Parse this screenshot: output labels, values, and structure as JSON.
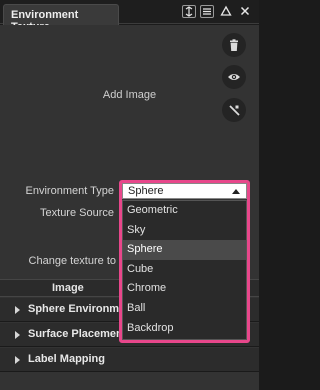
{
  "window": {
    "tab_title": "Environment Texture",
    "controls": [
      "pin-icon",
      "menu-icon",
      "triangle-icon",
      "close-icon"
    ]
  },
  "side_buttons": [
    "trash-icon",
    "eye-icon",
    "no-texture-icon"
  ],
  "add_image_label": "Add Image",
  "fields": {
    "environment_type_label": "Environment Type",
    "texture_source_label": "Texture Source",
    "change_texture_label": "Change texture to"
  },
  "environment_type": {
    "value": "Sphere",
    "options": [
      "Geometric",
      "Sky",
      "Sphere",
      "Cube",
      "Chrome",
      "Ball",
      "Backdrop"
    ],
    "selected_index": 2
  },
  "image_column_label": "Image",
  "sections": [
    {
      "label": "Sphere Environment"
    },
    {
      "label": "Surface Placement"
    },
    {
      "label": "Label Mapping"
    }
  ],
  "colors": {
    "highlight_outline": "#e8478b",
    "panel_bg": "#333333",
    "dropdown_bg": "#2a2a2a",
    "dropdown_selected": "#4a4a4a"
  }
}
